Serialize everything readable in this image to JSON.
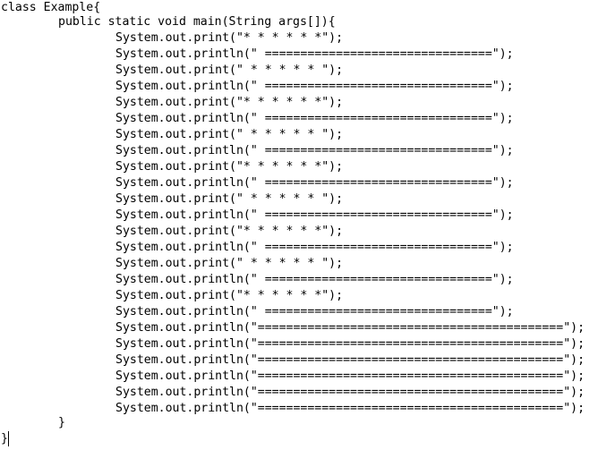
{
  "editor": {
    "lines": [
      "class Example{",
      "public static void main(String args[]){",
      "System.out.print(\"* * * * * *\");",
      "System.out.println(\" ================================\");",
      "System.out.print(\" * * * * * \");",
      "System.out.println(\" ================================\");",
      "System.out.print(\"* * * * * *\");",
      "System.out.println(\" ================================\");",
      "System.out.print(\" * * * * * \");",
      "System.out.println(\" ================================\");",
      "System.out.print(\"* * * * * *\");",
      "System.out.println(\" ================================\");",
      "System.out.print(\" * * * * * \");",
      "System.out.println(\" ================================\");",
      "System.out.print(\"* * * * * *\");",
      "System.out.println(\" ================================\");",
      "System.out.print(\" * * * * * \");",
      "System.out.println(\" ================================\");",
      "System.out.print(\"* * * * * *\");",
      "System.out.println(\" ================================\");",
      "System.out.println(\"===========================================\");",
      "System.out.println(\"===========================================\");",
      "System.out.println(\"===========================================\");",
      "System.out.println(\"===========================================\");",
      "System.out.println(\"===========================================\");",
      "System.out.println(\"===========================================\");",
      "}",
      "}"
    ]
  }
}
